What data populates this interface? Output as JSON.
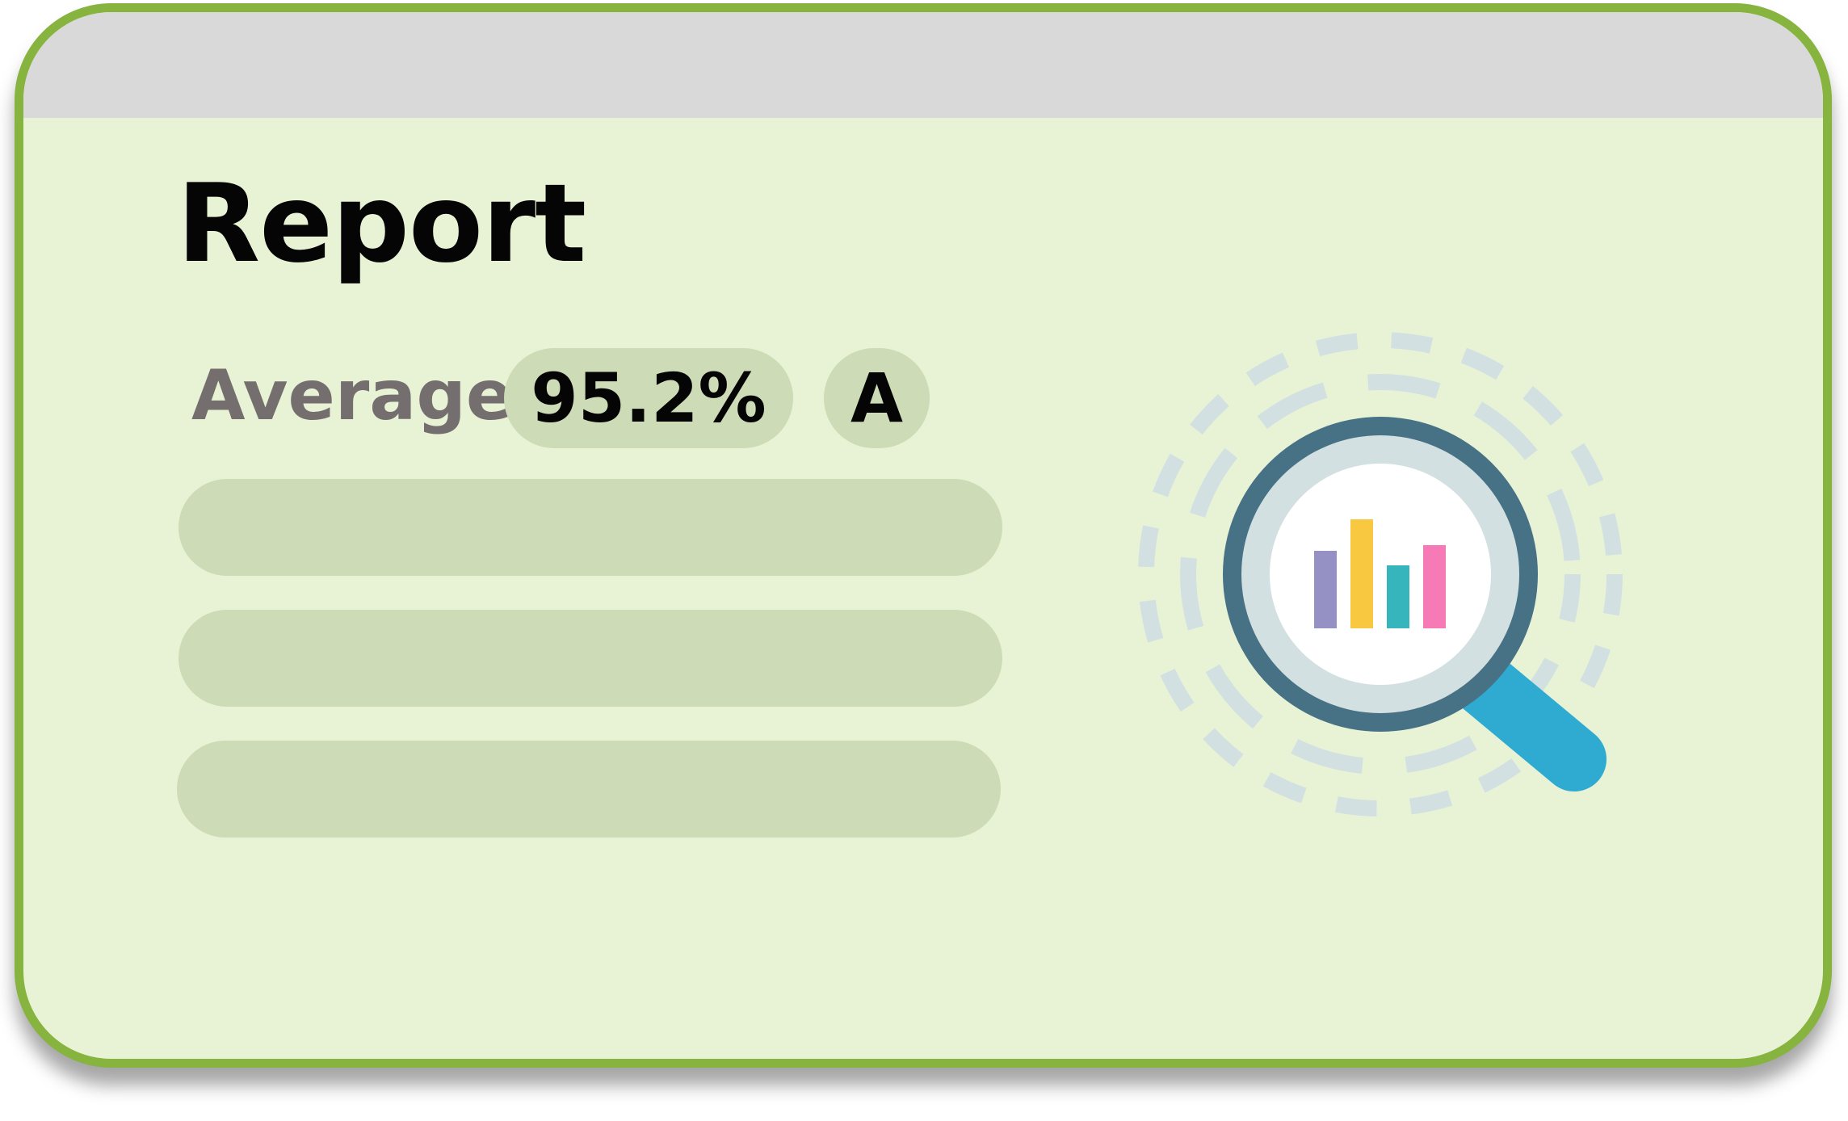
{
  "report": {
    "title": "Report",
    "average_label": "Average",
    "average_value": "95.2%",
    "grade": "A"
  },
  "placeholder_rows": 3,
  "illustration": {
    "icon": "magnifier-chart-icon",
    "colors": {
      "ring": "#477185",
      "lens_rim": "#d3e0e1",
      "handle": "#2faad1",
      "dashes": "#d3e0e1",
      "bar_purple": "#9591c5",
      "bar_yellow": "#f8c940",
      "bar_teal": "#36b5bd",
      "bar_pink": "#f57ab5"
    }
  },
  "colors": {
    "card_border": "#87b33f",
    "card_background": "#e8f3d6",
    "top_bar": "#d9d9d9",
    "pill": "#cddbb6"
  }
}
